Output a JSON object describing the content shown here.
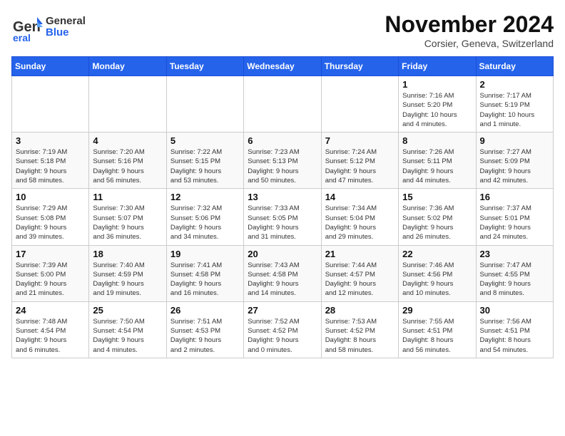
{
  "logo": {
    "general": "General",
    "blue": "Blue"
  },
  "title": "November 2024",
  "location": "Corsier, Geneva, Switzerland",
  "days_of_week": [
    "Sunday",
    "Monday",
    "Tuesday",
    "Wednesday",
    "Thursday",
    "Friday",
    "Saturday"
  ],
  "weeks": [
    [
      {
        "day": "",
        "info": ""
      },
      {
        "day": "",
        "info": ""
      },
      {
        "day": "",
        "info": ""
      },
      {
        "day": "",
        "info": ""
      },
      {
        "day": "",
        "info": ""
      },
      {
        "day": "1",
        "info": "Sunrise: 7:16 AM\nSunset: 5:20 PM\nDaylight: 10 hours\nand 4 minutes."
      },
      {
        "day": "2",
        "info": "Sunrise: 7:17 AM\nSunset: 5:19 PM\nDaylight: 10 hours\nand 1 minute."
      }
    ],
    [
      {
        "day": "3",
        "info": "Sunrise: 7:19 AM\nSunset: 5:18 PM\nDaylight: 9 hours\nand 58 minutes."
      },
      {
        "day": "4",
        "info": "Sunrise: 7:20 AM\nSunset: 5:16 PM\nDaylight: 9 hours\nand 56 minutes."
      },
      {
        "day": "5",
        "info": "Sunrise: 7:22 AM\nSunset: 5:15 PM\nDaylight: 9 hours\nand 53 minutes."
      },
      {
        "day": "6",
        "info": "Sunrise: 7:23 AM\nSunset: 5:13 PM\nDaylight: 9 hours\nand 50 minutes."
      },
      {
        "day": "7",
        "info": "Sunrise: 7:24 AM\nSunset: 5:12 PM\nDaylight: 9 hours\nand 47 minutes."
      },
      {
        "day": "8",
        "info": "Sunrise: 7:26 AM\nSunset: 5:11 PM\nDaylight: 9 hours\nand 44 minutes."
      },
      {
        "day": "9",
        "info": "Sunrise: 7:27 AM\nSunset: 5:09 PM\nDaylight: 9 hours\nand 42 minutes."
      }
    ],
    [
      {
        "day": "10",
        "info": "Sunrise: 7:29 AM\nSunset: 5:08 PM\nDaylight: 9 hours\nand 39 minutes."
      },
      {
        "day": "11",
        "info": "Sunrise: 7:30 AM\nSunset: 5:07 PM\nDaylight: 9 hours\nand 36 minutes."
      },
      {
        "day": "12",
        "info": "Sunrise: 7:32 AM\nSunset: 5:06 PM\nDaylight: 9 hours\nand 34 minutes."
      },
      {
        "day": "13",
        "info": "Sunrise: 7:33 AM\nSunset: 5:05 PM\nDaylight: 9 hours\nand 31 minutes."
      },
      {
        "day": "14",
        "info": "Sunrise: 7:34 AM\nSunset: 5:04 PM\nDaylight: 9 hours\nand 29 minutes."
      },
      {
        "day": "15",
        "info": "Sunrise: 7:36 AM\nSunset: 5:02 PM\nDaylight: 9 hours\nand 26 minutes."
      },
      {
        "day": "16",
        "info": "Sunrise: 7:37 AM\nSunset: 5:01 PM\nDaylight: 9 hours\nand 24 minutes."
      }
    ],
    [
      {
        "day": "17",
        "info": "Sunrise: 7:39 AM\nSunset: 5:00 PM\nDaylight: 9 hours\nand 21 minutes."
      },
      {
        "day": "18",
        "info": "Sunrise: 7:40 AM\nSunset: 4:59 PM\nDaylight: 9 hours\nand 19 minutes."
      },
      {
        "day": "19",
        "info": "Sunrise: 7:41 AM\nSunset: 4:58 PM\nDaylight: 9 hours\nand 16 minutes."
      },
      {
        "day": "20",
        "info": "Sunrise: 7:43 AM\nSunset: 4:58 PM\nDaylight: 9 hours\nand 14 minutes."
      },
      {
        "day": "21",
        "info": "Sunrise: 7:44 AM\nSunset: 4:57 PM\nDaylight: 9 hours\nand 12 minutes."
      },
      {
        "day": "22",
        "info": "Sunrise: 7:46 AM\nSunset: 4:56 PM\nDaylight: 9 hours\nand 10 minutes."
      },
      {
        "day": "23",
        "info": "Sunrise: 7:47 AM\nSunset: 4:55 PM\nDaylight: 9 hours\nand 8 minutes."
      }
    ],
    [
      {
        "day": "24",
        "info": "Sunrise: 7:48 AM\nSunset: 4:54 PM\nDaylight: 9 hours\nand 6 minutes."
      },
      {
        "day": "25",
        "info": "Sunrise: 7:50 AM\nSunset: 4:54 PM\nDaylight: 9 hours\nand 4 minutes."
      },
      {
        "day": "26",
        "info": "Sunrise: 7:51 AM\nSunset: 4:53 PM\nDaylight: 9 hours\nand 2 minutes."
      },
      {
        "day": "27",
        "info": "Sunrise: 7:52 AM\nSunset: 4:52 PM\nDaylight: 9 hours\nand 0 minutes."
      },
      {
        "day": "28",
        "info": "Sunrise: 7:53 AM\nSunset: 4:52 PM\nDaylight: 8 hours\nand 58 minutes."
      },
      {
        "day": "29",
        "info": "Sunrise: 7:55 AM\nSunset: 4:51 PM\nDaylight: 8 hours\nand 56 minutes."
      },
      {
        "day": "30",
        "info": "Sunrise: 7:56 AM\nSunset: 4:51 PM\nDaylight: 8 hours\nand 54 minutes."
      }
    ]
  ]
}
